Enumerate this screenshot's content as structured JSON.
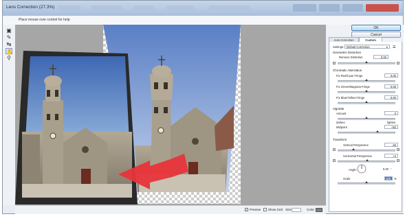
{
  "window": {
    "title": "Lens Correction (27.3%)",
    "ok_label": "OK",
    "cancel_label": "Cancel"
  },
  "hint_bar": {
    "text": "Place mouse over control for help"
  },
  "tabs": [
    {
      "label": "Auto Correction"
    },
    {
      "label": "Custom"
    }
  ],
  "settings": {
    "label": "Settings:",
    "value": "Default Correction"
  },
  "geometric_distortion": {
    "heading": "Geometric Distortion",
    "remove_distortion_label": "Remove Distortion",
    "remove_distortion_value": "0.00"
  },
  "chromatic_aberration": {
    "heading": "Chromatic Aberration",
    "items": [
      {
        "label": "Fix Red/Cyan Fringe",
        "value": "0.00"
      },
      {
        "label": "Fix Green/Magenta Fringe",
        "value": "0.00"
      },
      {
        "label": "Fix Blue/Yellow Fringe",
        "value": "0.00"
      }
    ]
  },
  "vignette": {
    "heading": "Vignette",
    "amount_label": "Amount",
    "amount_value": "0",
    "darken_label": "darken",
    "lighten_label": "lighten",
    "midpoint_label": "Midpoint",
    "midpoint_value": "+50"
  },
  "transform": {
    "heading": "Transform",
    "vertical_label": "Vertical Perspective",
    "vertical_value": "-46",
    "horizontal_label": "Horizontal Perspective",
    "horizontal_value": "+2",
    "angle_label": "Angle:",
    "angle_value": "0.00",
    "scale_label": "Scale",
    "scale_value": "100",
    "scale_unit": "%"
  },
  "statusbar": {
    "preview_label": "Preview",
    "grid_label": "Show Grid",
    "size_label": "Size:",
    "color_label": "Color:"
  },
  "colors": {
    "accent": "#e8343a",
    "ok_border": "#3c7fb1",
    "canvas_bg": "#a6a6a6"
  },
  "icons": [
    "lens-correction-tool-icon",
    "straighten-tool-icon",
    "move-grid-tool-icon",
    "hand-tool-icon",
    "zoom-tool-icon"
  ]
}
